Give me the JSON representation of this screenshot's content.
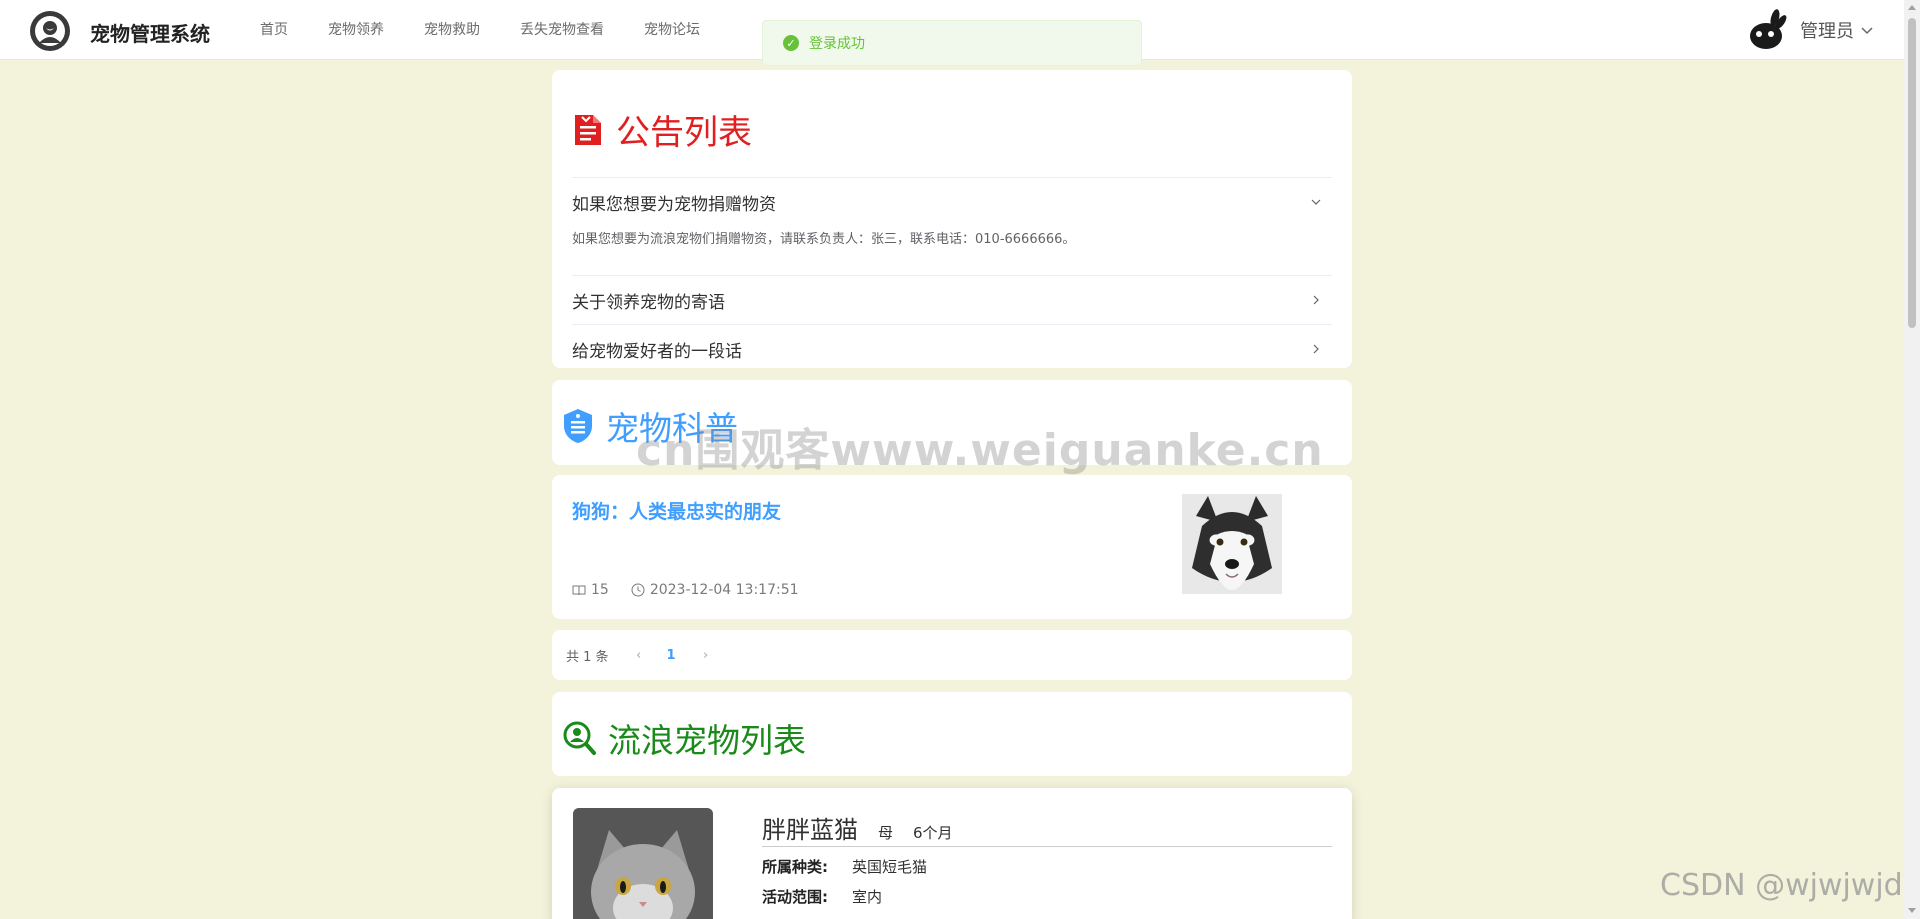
{
  "header": {
    "app_title": "宠物管理系统",
    "nav": [
      "首页",
      "宠物领养",
      "宠物救助",
      "丢失宠物查看",
      "宠物论坛"
    ],
    "user_name": "管理员"
  },
  "toast": {
    "message": "登录成功",
    "status_color": "#67c23a"
  },
  "notice": {
    "title": "公告列表",
    "title_color": "#e02020",
    "items": [
      {
        "title": "如果您想要为宠物捐赠物资",
        "content": "如果您想要为流浪宠物们捐赠物资，请联系负责人：张三，联系电话：010-6666666。",
        "expanded": true
      },
      {
        "title": "关于领养宠物的寄语",
        "expanded": false
      },
      {
        "title": "给宠物爱好者的一段话",
        "expanded": false
      }
    ]
  },
  "science": {
    "title": "宠物科普",
    "title_color": "#409eff",
    "article": {
      "title": "狗狗：人类最忠实的朋友",
      "views": "15",
      "date": "2023-12-04 13:17:51",
      "image_icon": "husky-photo"
    }
  },
  "pagination": {
    "total_text": "共 1 条",
    "current_page": "1"
  },
  "stray": {
    "title": "流浪宠物列表",
    "title_color": "#1a8a1a",
    "pet": {
      "name": "胖胖蓝猫",
      "gender": "母",
      "age": "6个月",
      "fields": [
        {
          "label": "所属种类:",
          "value": "英国短毛猫"
        },
        {
          "label": "活动范围:",
          "value": "室内"
        }
      ],
      "image_icon": "british-shorthair-photo"
    }
  },
  "watermarks": {
    "center": "cn围观客www.weiguanke.cn",
    "corner": "CSDN @wjwjwjd"
  }
}
